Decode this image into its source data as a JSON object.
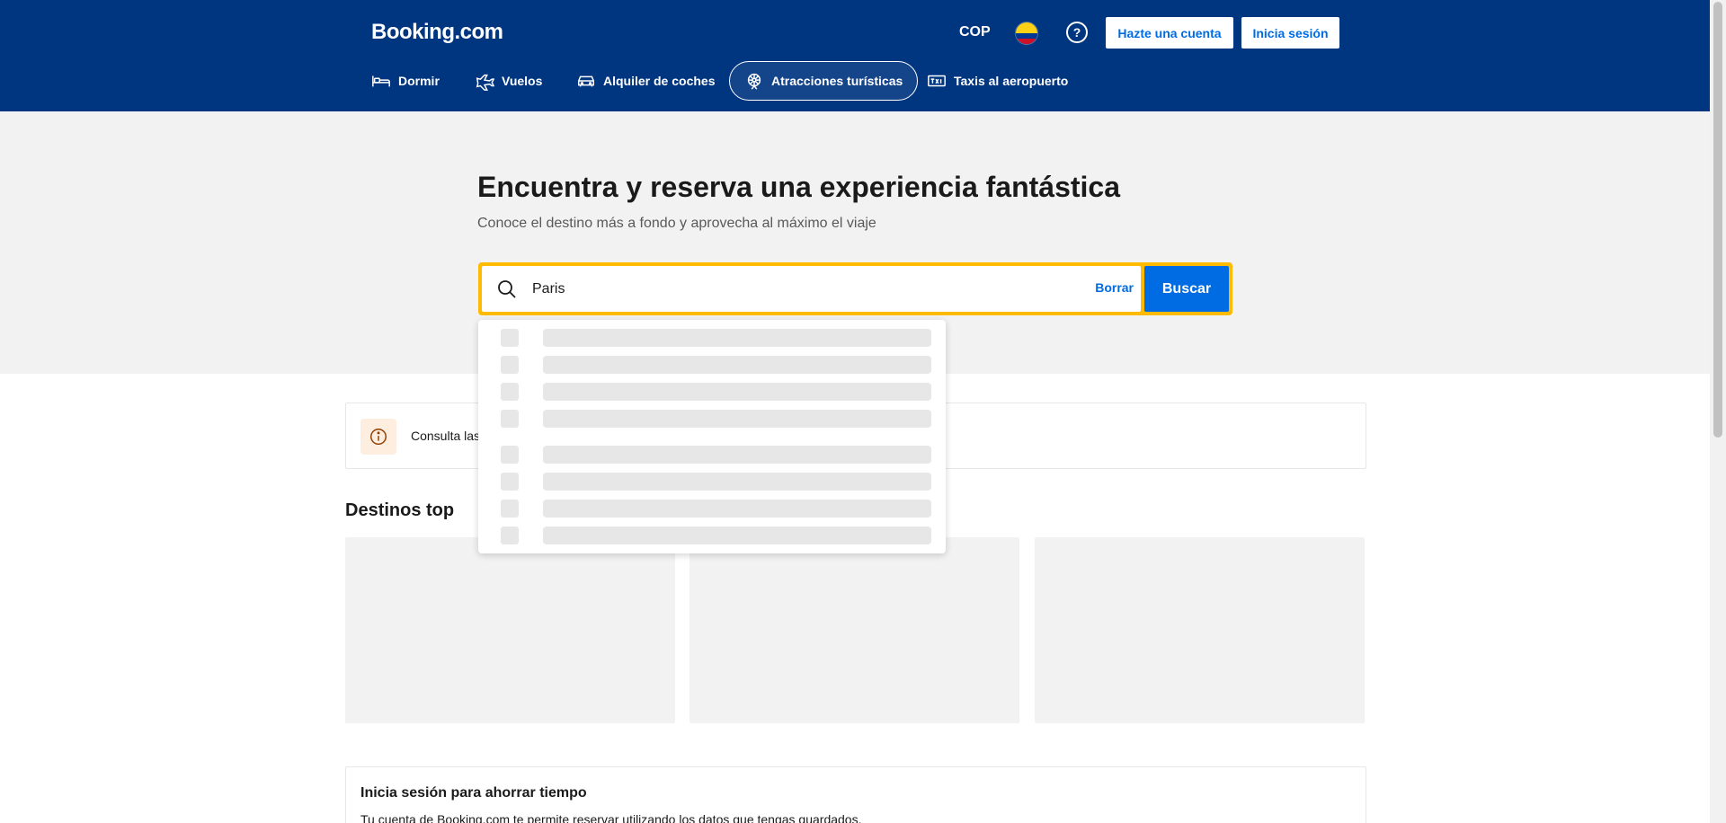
{
  "header": {
    "logo": "Booking.com",
    "currency": "COP",
    "help_symbol": "?",
    "signup_label": "Hazte una cuenta",
    "signin_label": "Inicia sesión"
  },
  "nav": {
    "items": [
      {
        "label": "Dormir",
        "icon": "bed-icon"
      },
      {
        "label": "Vuelos",
        "icon": "plane-icon"
      },
      {
        "label": "Alquiler de coches",
        "icon": "car-icon"
      },
      {
        "label": "Atracciones turísticas",
        "icon": "ferris-wheel-icon",
        "active": true
      },
      {
        "label": "Taxis al aeropuerto",
        "icon": "taxi-icon"
      }
    ]
  },
  "hero": {
    "title": "Encuentra y reserva una experiencia fantástica",
    "subtitle": "Conoce el destino más a fondo y aprovecha al máximo el viaje"
  },
  "search": {
    "value": "Paris",
    "clear_label": "Borrar",
    "submit_label": "Buscar"
  },
  "notice": {
    "text": "Consulta las"
  },
  "destinations": {
    "title": "Destinos top"
  },
  "login_prompt": {
    "title": "Inicia sesión para ahorrar tiempo",
    "text": "Tu cuenta de Booking.com te permite reservar utilizando los datos que tengas guardados."
  },
  "colors": {
    "brand_blue": "#003580",
    "action_blue": "#006ce4",
    "search_yellow": "#febb02",
    "hero_bg": "#f2f2f2"
  }
}
